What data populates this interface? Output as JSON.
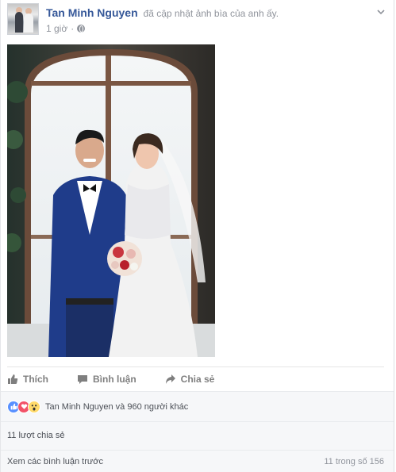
{
  "post": {
    "author": "Tan Minh Nguyen",
    "action": "đã cập nhật ảnh bìa của anh ấy.",
    "time": "1 giờ",
    "separator": "·"
  },
  "actions": {
    "like_label": "Thích",
    "comment_label": "Bình luận",
    "share_label": "Chia sẻ"
  },
  "reactions": {
    "types": [
      "like",
      "love",
      "wow"
    ],
    "summary": "Tan Minh Nguyen và 960 người khác"
  },
  "shares": {
    "label": "11 lượt chia sẻ"
  },
  "comments": {
    "view_previous": "Xem các bình luận trước",
    "count": "11 trong số 156"
  },
  "colors": {
    "author_link": "#365899",
    "like": "#5890ff",
    "love": "#f25268",
    "wow": "#ffda6a"
  }
}
